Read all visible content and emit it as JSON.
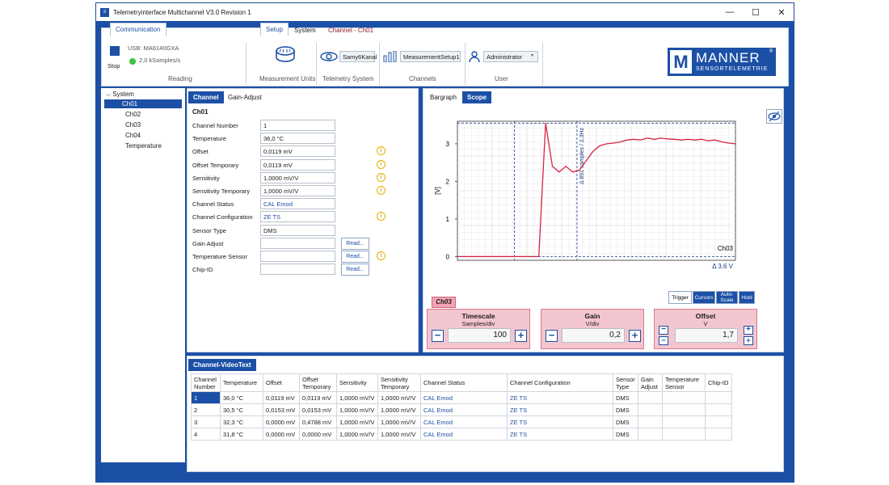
{
  "window": {
    "title": "Telemetryinterface Multichannel V3.0 Revision 1",
    "minimize": "—",
    "maximize": "☐",
    "close": "✕"
  },
  "ribbon": {
    "tabs": [
      {
        "label": "Communication"
      },
      {
        "label": "Setup"
      },
      {
        "label": "System"
      },
      {
        "label": "Channel - Ch01"
      }
    ],
    "reading": {
      "usb": "USB: MA6140GXA",
      "samples": "2,0 kSamples/s",
      "stop_label": "Stop",
      "group_label": "Reading"
    },
    "measurement_units_label": "Measurement Units",
    "telemetry": {
      "value": "Samy6Kanal",
      "group_label": "Telemetry System"
    },
    "channels": {
      "value": "MeasurementSetup1",
      "group_label": "Channels"
    },
    "user": {
      "value": "Administrator",
      "group_label": "User"
    },
    "logo": {
      "name": "MANNER",
      "sub": "SENSORTELEMETRIE",
      "reg": "®",
      "mark": "M"
    }
  },
  "tree": {
    "root": "System",
    "items": [
      "Ch01",
      "Ch02",
      "Ch03",
      "Ch04",
      "Temperature"
    ],
    "selected": "Ch01"
  },
  "channel_panel": {
    "tabs": [
      "Channel",
      "Gain-Adjust"
    ],
    "heading": "Ch01",
    "fields": [
      {
        "label": "Channel Number",
        "value": "1"
      },
      {
        "label": "Temperature",
        "value": "36,0 °C"
      },
      {
        "label": "Offset",
        "value": "0,0119 mV"
      },
      {
        "label": "Offset Temporary",
        "value": "0,0119 mV"
      },
      {
        "label": "Sensitivity",
        "value": "1,0000 mV/V"
      },
      {
        "label": "Sensitivity Temporary",
        "value": "1,0000 mV/V"
      },
      {
        "label": "Channel Status",
        "value": "CAL    Emod"
      },
      {
        "label": "Channel Configuration",
        "value": "ZE    TS"
      },
      {
        "label": "Sensor Type",
        "value": "DMS"
      },
      {
        "label": "Gain Adjust",
        "value": ""
      },
      {
        "label": "Temperature Sensor",
        "value": ""
      },
      {
        "label": "Chip-ID",
        "value": ""
      }
    ],
    "read_label": "Read...",
    "info_glyph": "i"
  },
  "scope_panel": {
    "tabs": [
      "Bargraph",
      "Scope"
    ],
    "ylabel": "[V]",
    "yticks": [
      "0",
      "1",
      "2",
      "3"
    ],
    "annotation": "Δ 891 samples / 2,3Hz",
    "channel_label": "Ch03",
    "delta_label": "Δ 3,6 V",
    "chip": "Ch03",
    "buttons": [
      "Trigger",
      "Cursors",
      "Auto-Scale",
      "Hold"
    ],
    "timescale": {
      "title": "Timescale",
      "unit": "Samples/div",
      "value": "100"
    },
    "gain": {
      "title": "Gain",
      "unit": "V/div",
      "value": "0,2"
    },
    "offset": {
      "title": "Offset",
      "unit": "V",
      "value": "1,7"
    },
    "minus": "−",
    "plus": "+",
    "trace_color": "#d62240"
  },
  "chart_data": {
    "type": "line",
    "ylabel": "[V]",
    "ylim": [
      -0.1,
      3.6
    ],
    "series": [
      {
        "values": [
          0,
          0,
          0,
          0,
          0,
          0,
          0,
          0,
          0,
          0,
          0,
          0,
          0,
          3.55,
          2.4,
          2.25,
          2.4,
          2.25,
          2.3,
          2.55,
          2.8,
          2.95,
          3.0,
          3.02,
          3.05,
          3.1,
          3.12,
          3.1,
          3.15,
          3.12,
          3.15,
          3.13,
          3.12,
          3.1,
          3.12,
          3.1,
          3.12,
          3.08,
          3.1,
          3.05,
          3.02,
          3.0
        ]
      }
    ]
  },
  "videotext": {
    "tab": "Channel-VideoText",
    "headers": [
      "Channel Number",
      "Temperature",
      "Offset",
      "Offset Temporary",
      "Sensitivity",
      "Sensitivity Temporary",
      "Channel Status",
      "Channel Configuration",
      "Sensor Type",
      "Gain Adjust",
      "Temperature Sensor",
      "Chip-ID"
    ],
    "rows": [
      [
        "1",
        "36,0 °C",
        "0,0119 mV",
        "0,0119 mV",
        "1,0000 mV/V",
        "1,0000 mV/V",
        "CAL    Emod",
        "ZE    TS",
        "DMS",
        "",
        "",
        ""
      ],
      [
        "2",
        "30,5 °C",
        "0,0153 mV",
        "0,0153 mV",
        "1,0000 mV/V",
        "1,0000 mV/V",
        "CAL    Emod",
        "ZE    TS",
        "DMS",
        "",
        "",
        ""
      ],
      [
        "3",
        "32,3 °C",
        "0,0000 mV",
        "0,4788 mV",
        "1,0000 mV/V",
        "1,0000 mV/V",
        "CAL    Emod",
        "ZE    TS",
        "DMS",
        "",
        "",
        ""
      ],
      [
        "4",
        "31,8 °C",
        "0,0000 mV",
        "0,0000 mV",
        "1,0000 mV/V",
        "1,0000 mV/V",
        "CAL    Emod",
        "ZE    TS",
        "DMS",
        "",
        "",
        ""
      ]
    ]
  }
}
